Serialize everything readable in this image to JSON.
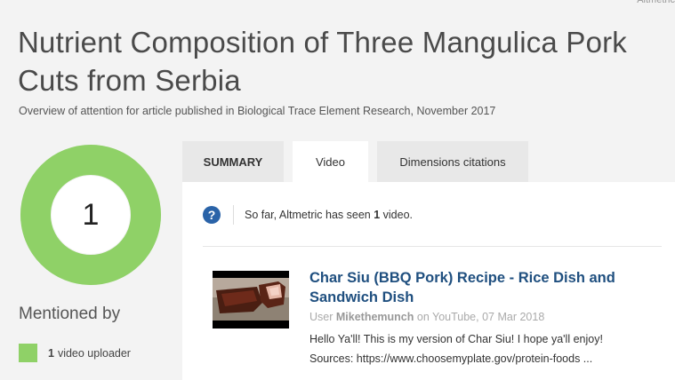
{
  "header": {
    "title": "Nutrient Composition of Three Mangulica Pork Cuts from Serbia",
    "subtitle": "Overview of attention for article published in Biological Trace Element Research, November 2017"
  },
  "score": {
    "value": "1",
    "color": "#8fd167"
  },
  "mentioned_by": {
    "title": "Mentioned by",
    "items": [
      {
        "count": "1",
        "label": "video uploader",
        "color": "#8fd167"
      }
    ]
  },
  "tabs": [
    {
      "label": "SUMMARY",
      "active": false
    },
    {
      "label": "Video",
      "active": true
    },
    {
      "label": "Dimensions citations",
      "active": false
    }
  ],
  "info": {
    "icon": "question-icon",
    "prefix": "So far, Altmetric has seen ",
    "count": "1",
    "suffix": " video."
  },
  "video": {
    "title": "Char Siu (BBQ Pork) Recipe - Rice Dish and Sandwich Dish",
    "meta_prefix": "User ",
    "user": "Mikethemunch",
    "meta_suffix": " on YouTube, 07 Mar 2018",
    "desc_line1": "Hello Ya'll! This is my version of Char Siu! I hope ya'll enjoy!",
    "desc_line2": "Sources: https://www.choosemyplate.gov/protein-foods ..."
  }
}
